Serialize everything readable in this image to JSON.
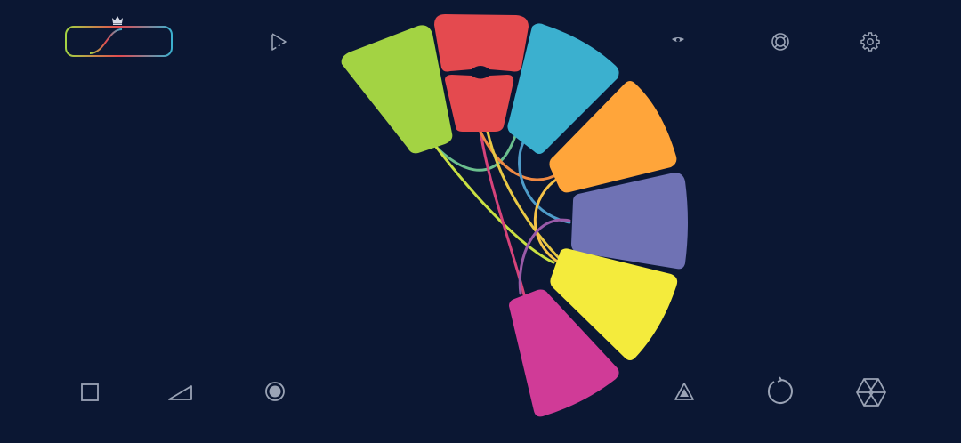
{
  "theme": {
    "background": "#0b1733",
    "icon_color": "#9aa3b5"
  },
  "top_bar": {
    "curve_selector": {
      "gradient": [
        "#a3d343",
        "#e44a4f",
        "#3bb0cf"
      ]
    },
    "premium_icon": "crown-icon",
    "play_icon": "play-icon",
    "hide_icon": "eye-icon",
    "help_icon": "lifebuoy-icon",
    "settings_icon": "gear-icon"
  },
  "bottom_bar": {
    "shapes": [
      "square-icon",
      "triangle-icon",
      "circle-icon"
    ],
    "actions": [
      "warning-icon",
      "restart-icon",
      "aperture-icon"
    ]
  },
  "puzzle": {
    "segments": [
      {
        "id": "green",
        "color": "#a3d343"
      },
      {
        "id": "red-top",
        "color": "#e44a4f"
      },
      {
        "id": "red-bottom",
        "color": "#e44a4f"
      },
      {
        "id": "cyan",
        "color": "#3bb0cf"
      },
      {
        "id": "orange",
        "color": "#ffa53a"
      },
      {
        "id": "purple",
        "color": "#6f72b4"
      },
      {
        "id": "yellow",
        "color": "#f4eb3c"
      },
      {
        "id": "magenta",
        "color": "#d03b97"
      }
    ]
  }
}
